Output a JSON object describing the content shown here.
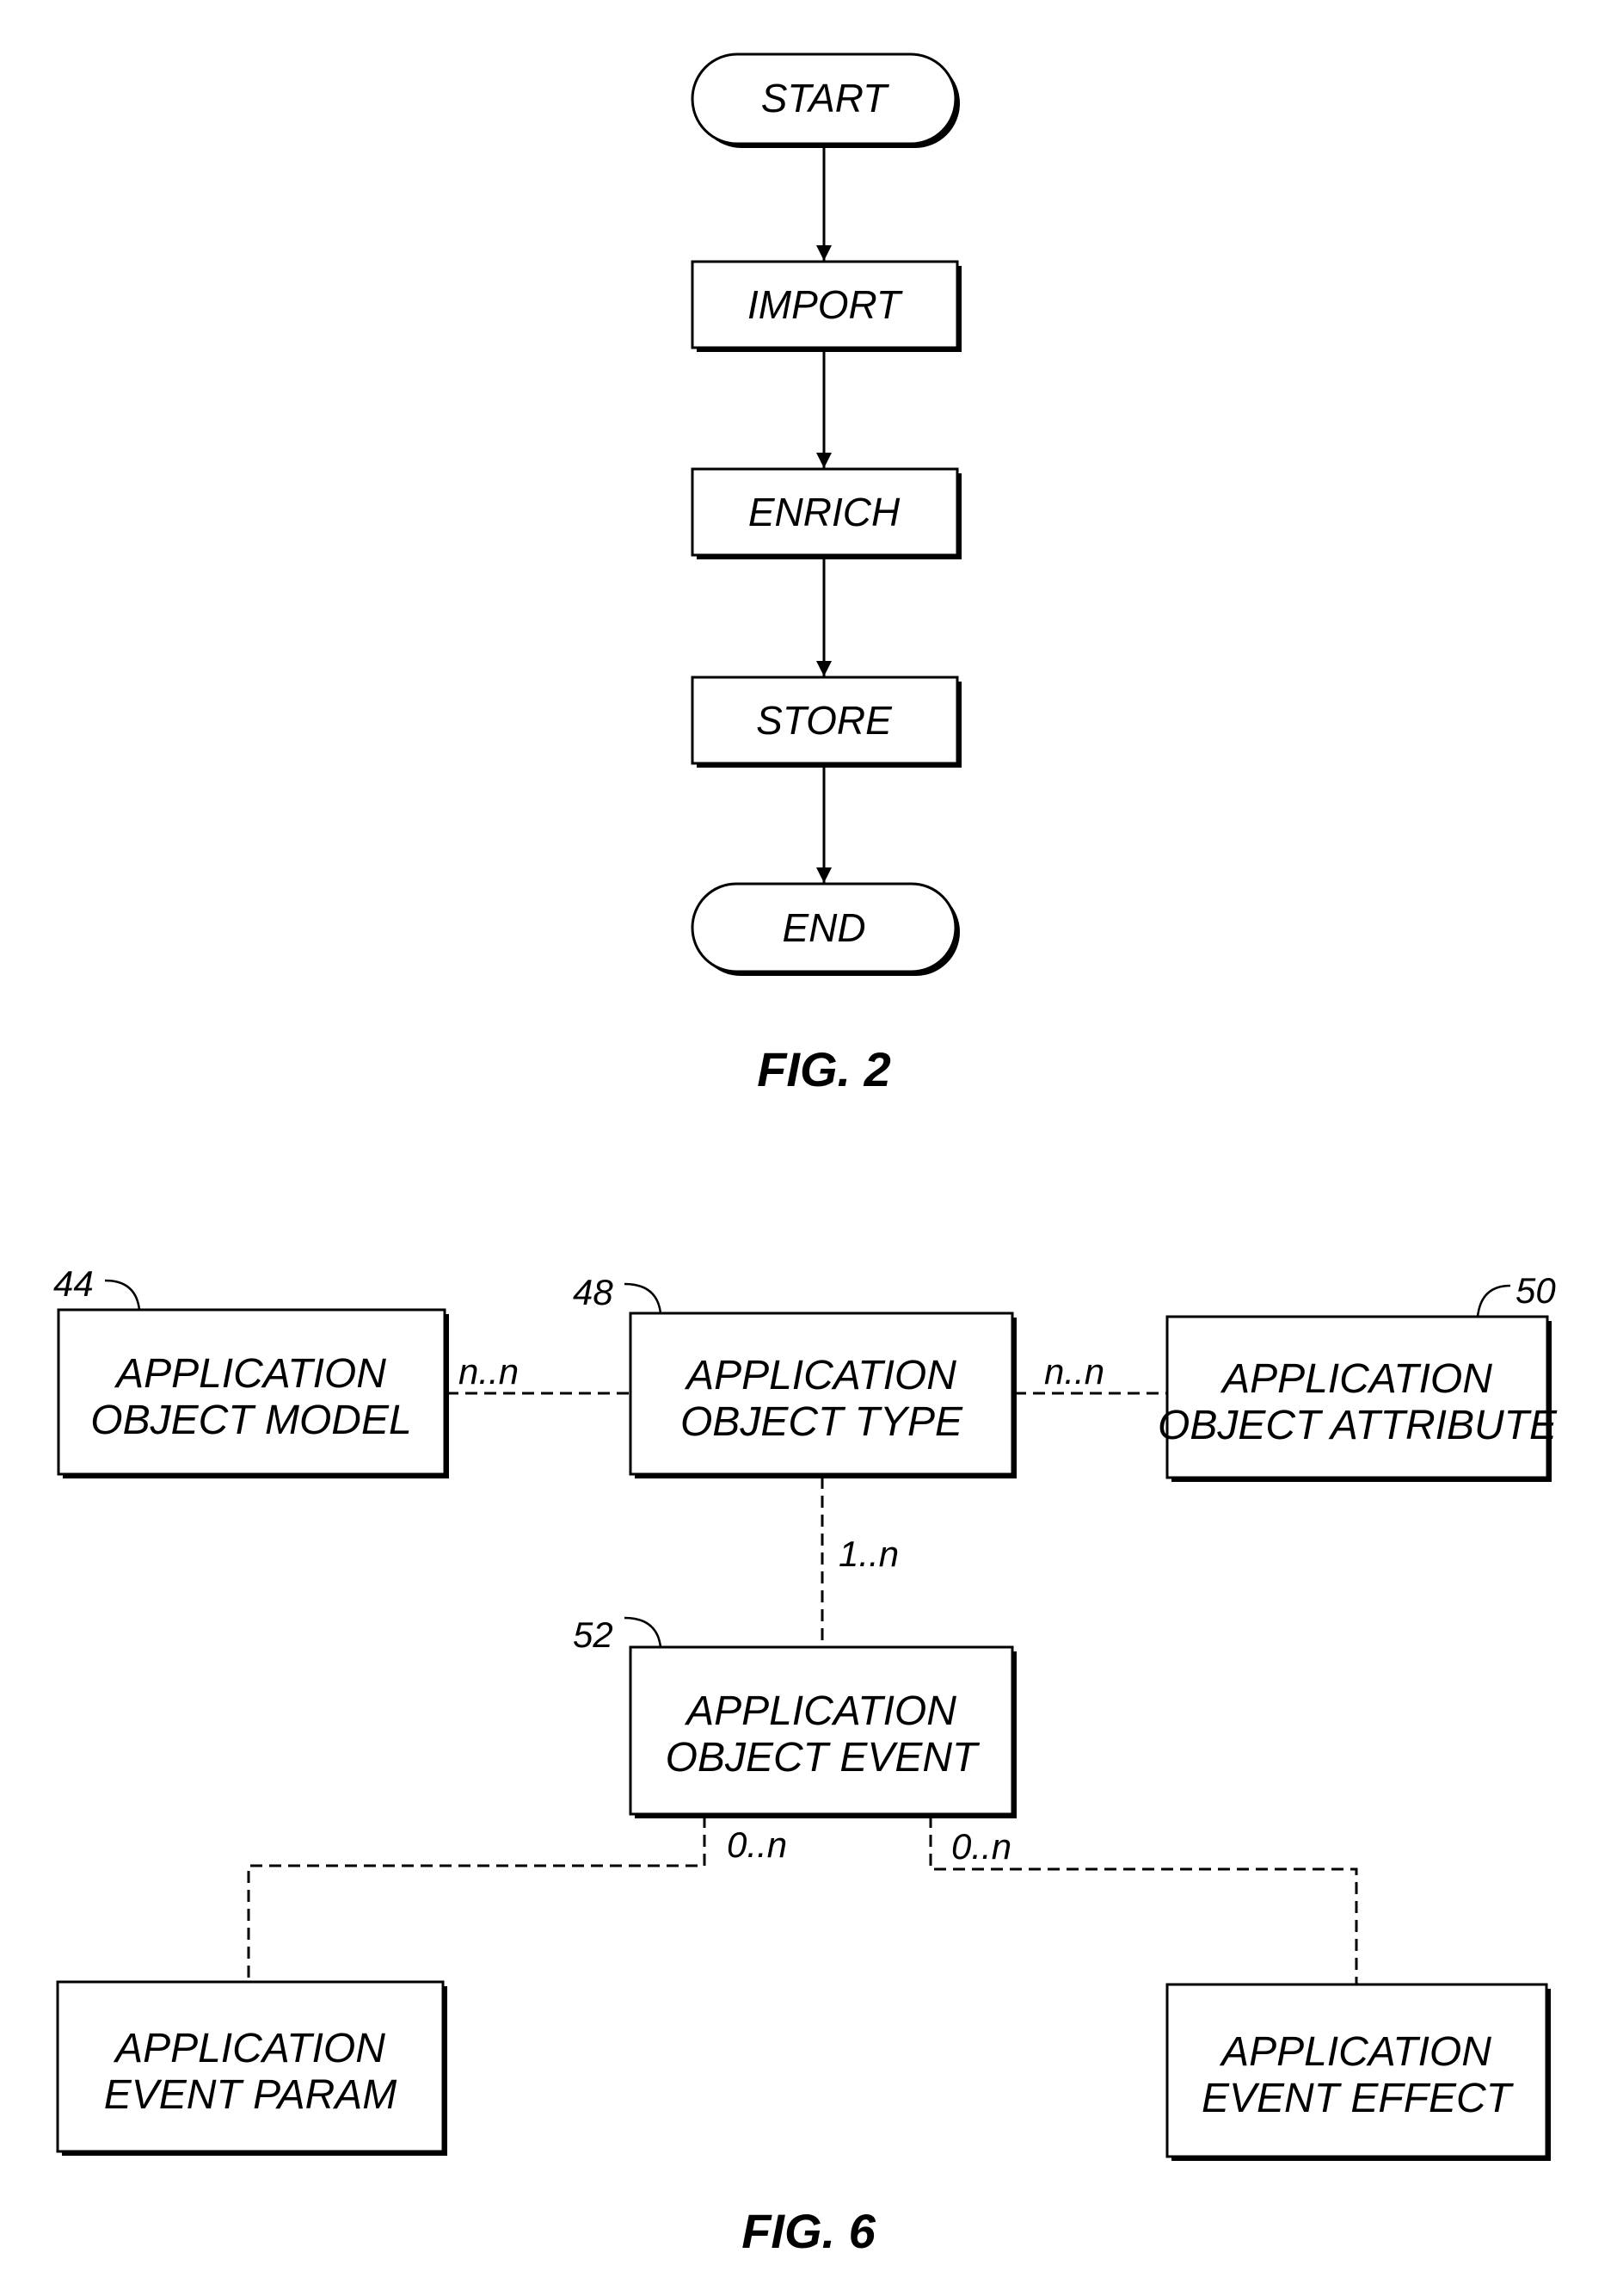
{
  "fig2": {
    "caption": "FIG. 2",
    "nodes": [
      {
        "id": "start",
        "shape": "terminal",
        "label": "START"
      },
      {
        "id": "import",
        "shape": "process",
        "label": "IMPORT"
      },
      {
        "id": "enrich",
        "shape": "process",
        "label": "ENRICH"
      },
      {
        "id": "store",
        "shape": "process",
        "label": "STORE"
      },
      {
        "id": "end",
        "shape": "terminal",
        "label": "END"
      }
    ],
    "edges": [
      {
        "from": "start",
        "to": "import"
      },
      {
        "from": "import",
        "to": "enrich"
      },
      {
        "from": "enrich",
        "to": "store"
      },
      {
        "from": "store",
        "to": "end"
      }
    ]
  },
  "fig6": {
    "caption": "FIG. 6",
    "entities": [
      {
        "id": "model",
        "ref": "44",
        "lines": [
          "APPLICATION",
          "OBJECT MODEL"
        ]
      },
      {
        "id": "type",
        "ref": "48",
        "lines": [
          "APPLICATION",
          "OBJECT TYPE"
        ]
      },
      {
        "id": "attribute",
        "ref": "50",
        "lines": [
          "APPLICATION",
          "OBJECT ATTRIBUTE"
        ]
      },
      {
        "id": "event",
        "ref": "52",
        "lines": [
          "APPLICATION",
          "OBJECT EVENT"
        ]
      },
      {
        "id": "param",
        "ref": "",
        "lines": [
          "APPLICATION",
          "EVENT PARAM"
        ]
      },
      {
        "id": "effect",
        "ref": "",
        "lines": [
          "APPLICATION",
          "EVENT EFFECT"
        ]
      }
    ],
    "relations": [
      {
        "from": "model",
        "to": "type",
        "cardinality": "n..n"
      },
      {
        "from": "type",
        "to": "attribute",
        "cardinality": "n..n"
      },
      {
        "from": "type",
        "to": "event",
        "cardinality": "1..n"
      },
      {
        "from": "event",
        "to": "param",
        "cardinality": "0..n"
      },
      {
        "from": "event",
        "to": "effect",
        "cardinality": "0..n"
      }
    ]
  }
}
